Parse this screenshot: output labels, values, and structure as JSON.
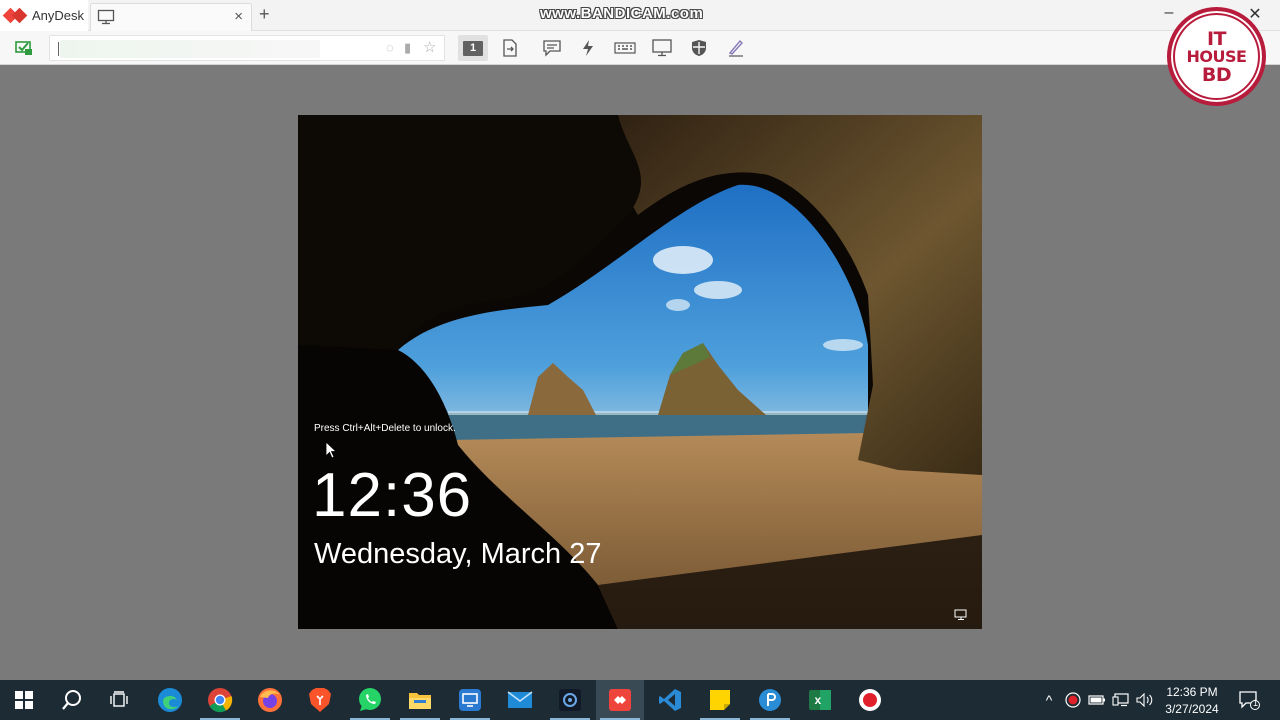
{
  "titlebar": {
    "app_name": "AnyDesk",
    "new_tab": "+",
    "close_tab": "×",
    "watermark": "www.BANDICAM.com",
    "minimize": "–",
    "maximize": "☐",
    "close": "✕"
  },
  "toolbar": {
    "monitor_number": "1",
    "icons": [
      "status-icon",
      "file-transfer-icon",
      "chat-icon",
      "actions-icon",
      "keyboard-icon",
      "display-icon",
      "permissions-icon",
      "whiteboard-icon"
    ]
  },
  "badge": {
    "line1": "IT",
    "line2": "HOUSE",
    "line3": "BD"
  },
  "lockscreen": {
    "hint": "Press Ctrl+Alt+Delete to unlock.",
    "time": "12:36",
    "date": "Wednesday, March 27"
  },
  "taskbar": {
    "apps": [
      "start-icon",
      "search-icon",
      "task-view-icon",
      "edge-icon",
      "chrome-icon",
      "firefox-icon",
      "brave-icon",
      "whatsapp-icon",
      "file-explorer-icon",
      "remote-desktop-icon",
      "mail-icon",
      "camera-app-icon",
      "anydesk-icon",
      "vscode-icon",
      "sticky-notes-icon",
      "pycharm-icon",
      "excel-icon",
      "record-icon"
    ],
    "excel_letter": "x",
    "tray_chevron": "^",
    "time": "12:36 PM",
    "date": "3/27/2024",
    "notification_count": "1"
  },
  "colors": {
    "anydesk_red": "#ef443b",
    "badge_red": "#b81c3c",
    "taskbar": "#1c2b34",
    "viewer_background": "#7a7a7a"
  }
}
